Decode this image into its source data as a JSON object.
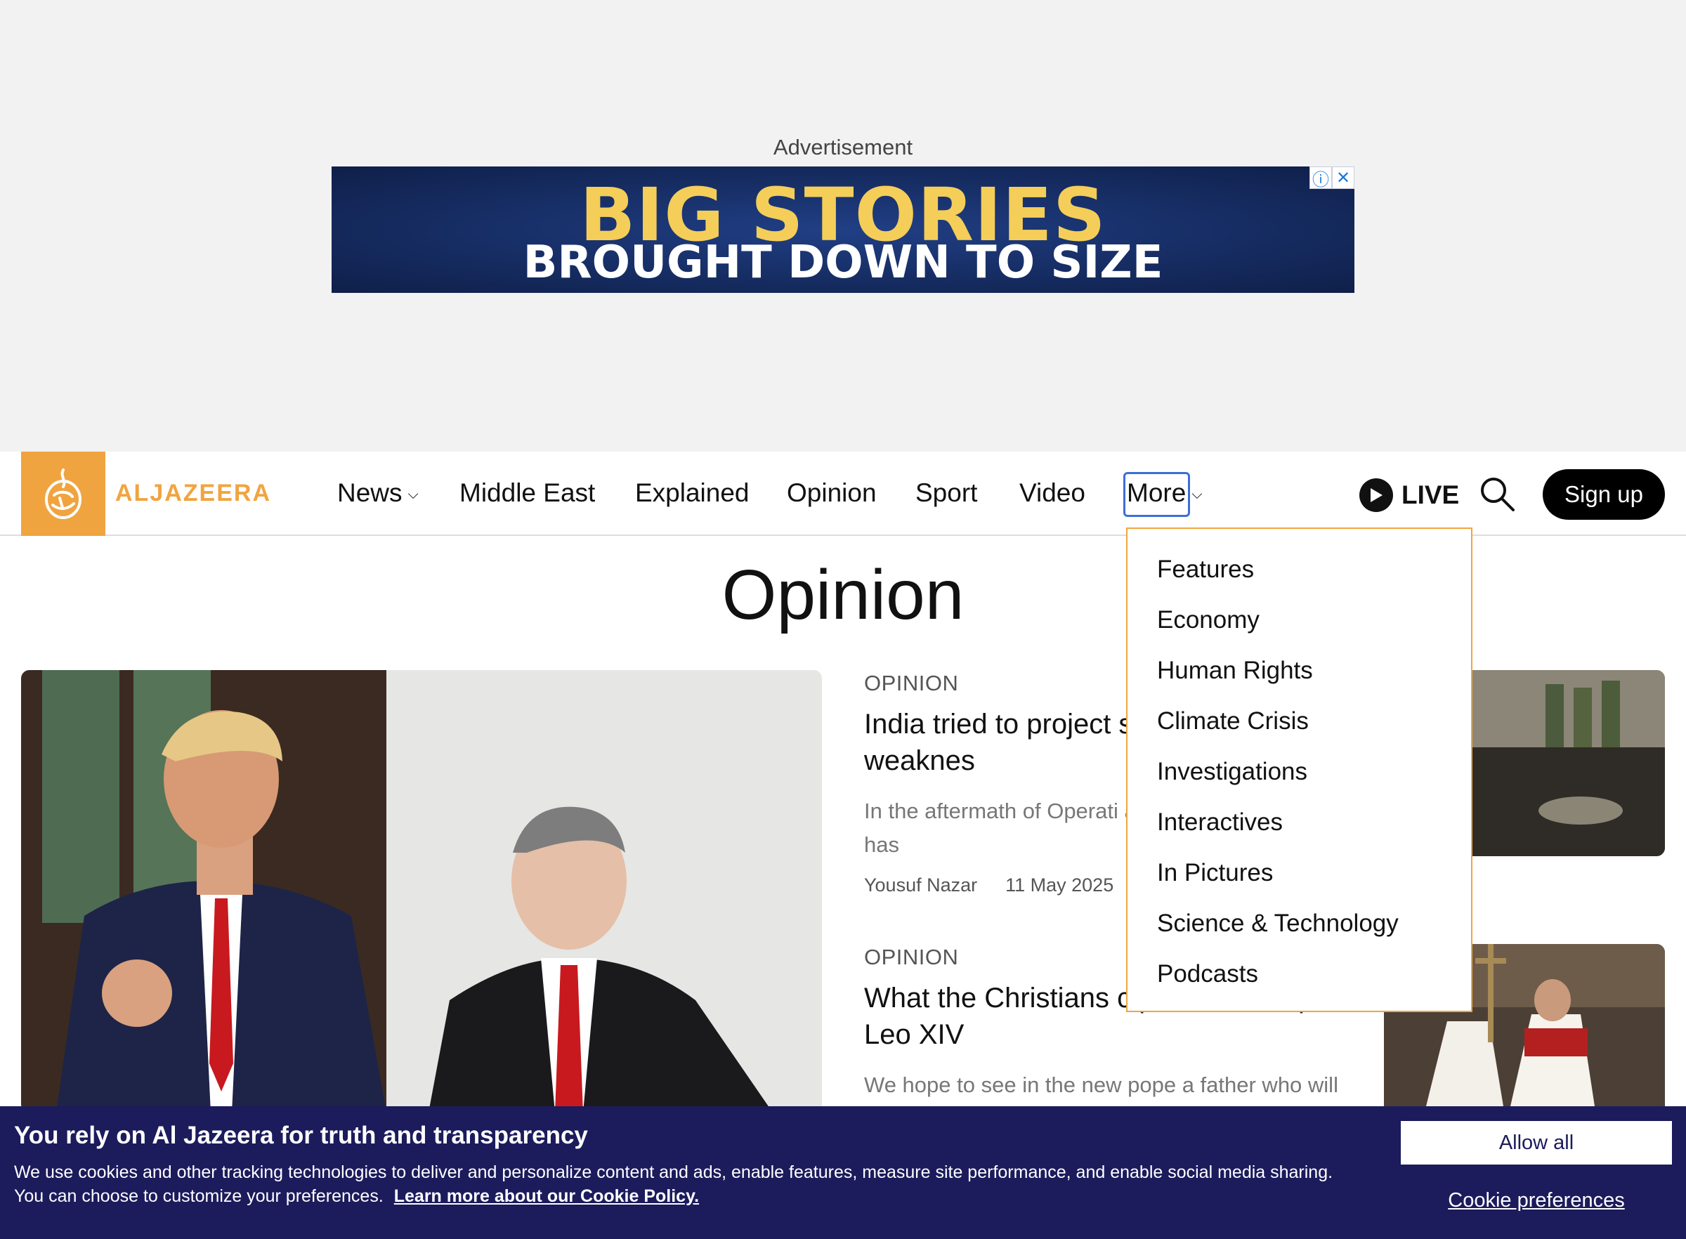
{
  "ad": {
    "label": "Advertisement",
    "headline": "BIG STORIES",
    "subline": "BROUGHT DOWN TO SIZE",
    "info_icon": "info-icon",
    "close_icon": "close-icon"
  },
  "nav": {
    "logo_text": "ALJAZEERA",
    "items": [
      "News",
      "Middle East",
      "Explained",
      "Opinion",
      "Sport",
      "Video",
      "More"
    ],
    "live_label": "LIVE",
    "signup_label": "Sign up"
  },
  "more_menu": {
    "items": [
      "Features",
      "Economy",
      "Human Rights",
      "Climate Crisis",
      "Investigations",
      "Interactives",
      "In Pictures",
      "Science & Technology",
      "Podcasts"
    ]
  },
  "page": {
    "title": "Opinion"
  },
  "articles": [
    {
      "kicker": "OPINION",
      "headline": "India tried to project s up showing weaknes",
      "summary": "In the aftermath of Operati as a regional hegemon has",
      "author": "Yousuf Nazar",
      "date": "11 May 2025"
    },
    {
      "kicker": "OPINION",
      "headline": "What the Christians c pect from Pope Leo XIV",
      "summary": "We hope to see in the new pope a father who will"
    }
  ],
  "cookie": {
    "title": "You rely on Al Jazeera for truth and transparency",
    "text": "We use cookies and other tracking technologies to deliver and personalize content and ads, enable features, measure site performance, and enable social media sharing. You can choose to customize your preferences.",
    "link": "Learn more about our Cookie Policy.",
    "allow_label": "Allow all",
    "prefs_label": "Cookie preferences"
  },
  "colors": {
    "brand_orange": "#f0a440",
    "cookie_bg": "#1c1b5c",
    "focus_blue": "#3b6fd6"
  }
}
